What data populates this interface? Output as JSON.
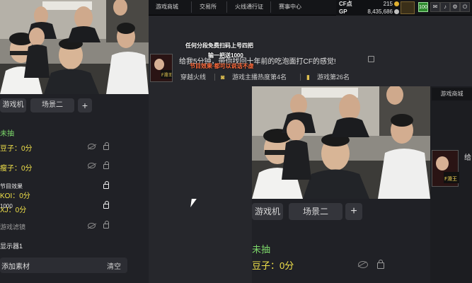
{
  "game_bar": {
    "tabs": [
      "游戏商城",
      "交易所",
      "火线通行证",
      "赛事中心"
    ],
    "cf_label": "CF点",
    "cf_value": "215",
    "gp_label": "GP",
    "gp_value": "8,435,686",
    "level_badge": "100",
    "icons": [
      "mail-icon",
      "speaker-icon",
      "settings-icon",
      "power-icon"
    ]
  },
  "stream": {
    "overlay_line1": "任何分段免费扫码上号四把",
    "overlay_line2": "输一把送1000",
    "overlay_line3": "节目效果·都可以说话不虚",
    "title": "给我5分钟，带你找回十年前的吃泡面打CF的感觉!",
    "tags": [
      "穿越火线",
      "游戏主播热度第4名",
      "游戏第26名"
    ],
    "avatar_text": "F滑王"
  },
  "scene_panel": {
    "scene_tabs": [
      "游戏机",
      "场景二"
    ],
    "add_label": "+",
    "sources": [
      {
        "label": "未抽",
        "color": "#7dd86a"
      },
      {
        "label": "豆子：0分",
        "color": "#f2e24a"
      },
      {
        "label": "瘦子：0分",
        "color": "#f2e24a"
      },
      {
        "label": "节目效果",
        "color": "#e8e8e8"
      },
      {
        "label": "KOI：0分",
        "color": "#f2e24a"
      },
      {
        "label": "1000",
        "color": "#e8e8e8"
      },
      {
        "label": "XJ：0分",
        "color": "#f2e24a"
      },
      {
        "label": "游戏滤镜",
        "color": "#9a9a9a"
      },
      {
        "label": "显示器1",
        "color": "#e8e8e8"
      }
    ],
    "add_source_label": "添加素材",
    "clear_label": "清空"
  },
  "right_preview": {
    "tab_label": "游戏商城",
    "scene_tabs": [
      "游戏机",
      "场景二"
    ],
    "add_label": "+",
    "source1": "未抽",
    "source2": "豆子：0分",
    "side_text": "给"
  }
}
